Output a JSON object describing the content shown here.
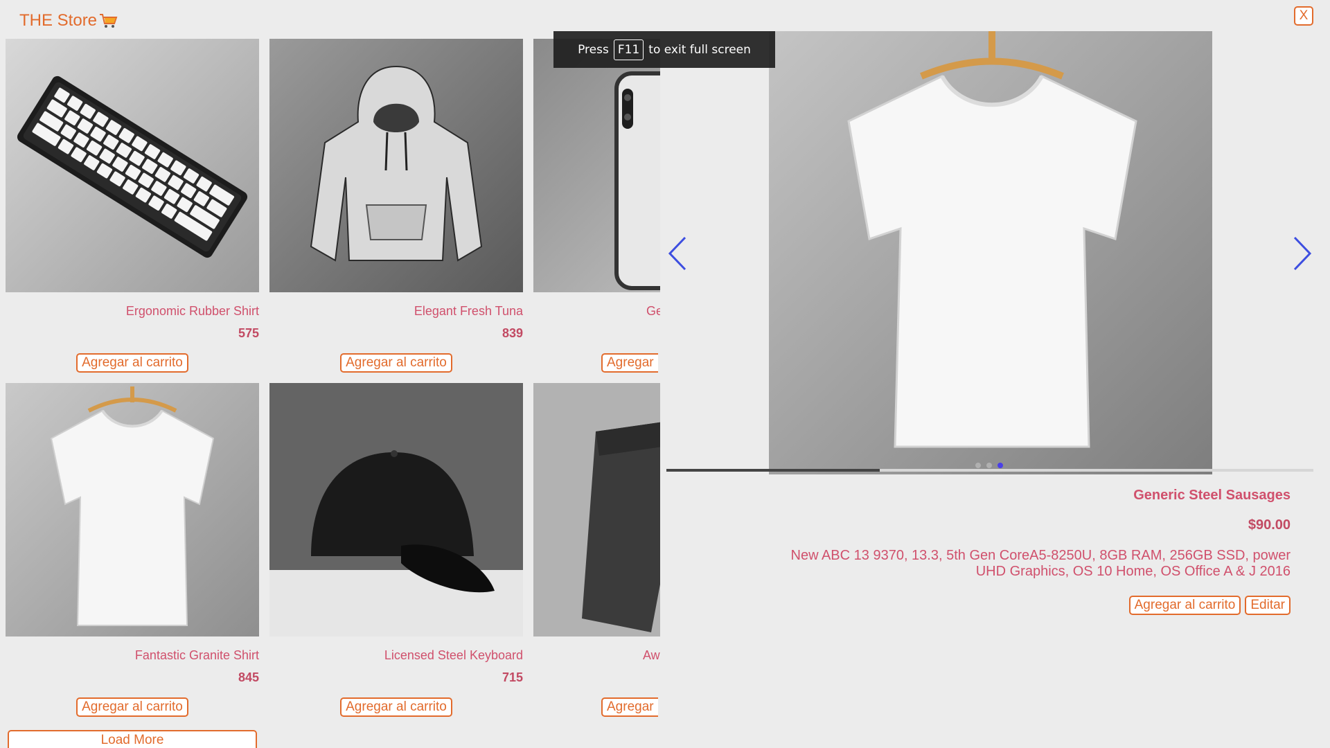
{
  "app": {
    "title": "THE Store",
    "cart_icon": "shopping-cart-icon",
    "accent_color": "#e26b2c",
    "text_color": "#d0506c"
  },
  "products": [
    {
      "name": "Ergonomic Rubber Shirt",
      "price": "575",
      "button": "Agregar al carrito",
      "image": "keyboard"
    },
    {
      "name": "Elegant Fresh Tuna",
      "price": "839",
      "button": "Agregar al carrito",
      "image": "hoodie"
    },
    {
      "name": "Ge",
      "price": "",
      "button": "Agregar",
      "image": "phone"
    },
    {
      "name": "Fantastic Granite Shirt",
      "price": "845",
      "button": "Agregar al carrito",
      "image": "tshirt"
    },
    {
      "name": "Licensed Steel Keyboard",
      "price": "715",
      "button": "Agregar al carrito",
      "image": "cap"
    },
    {
      "name": "Aw",
      "price": "",
      "button": "Agregar",
      "image": "shorts"
    }
  ],
  "load_more": "Load More",
  "modal": {
    "title": "Generic Steel Sausages",
    "price": "$90.00",
    "description": "New ABC 13 9370, 13.3, 5th Gen CoreA5-8250U, 8GB RAM, 256GB SSD, power UHD Graphics, OS 10 Home, OS Office A & J 2016",
    "add_to_cart": "Agregar al carrito",
    "edit": "Editar",
    "close": "X",
    "image": "tshirt",
    "carousel": {
      "slide_count": 3,
      "active_index": 2,
      "progress": 0.33
    }
  },
  "fullscreen_banner": {
    "before": "Press",
    "key": "F11",
    "after": "to exit full screen"
  }
}
